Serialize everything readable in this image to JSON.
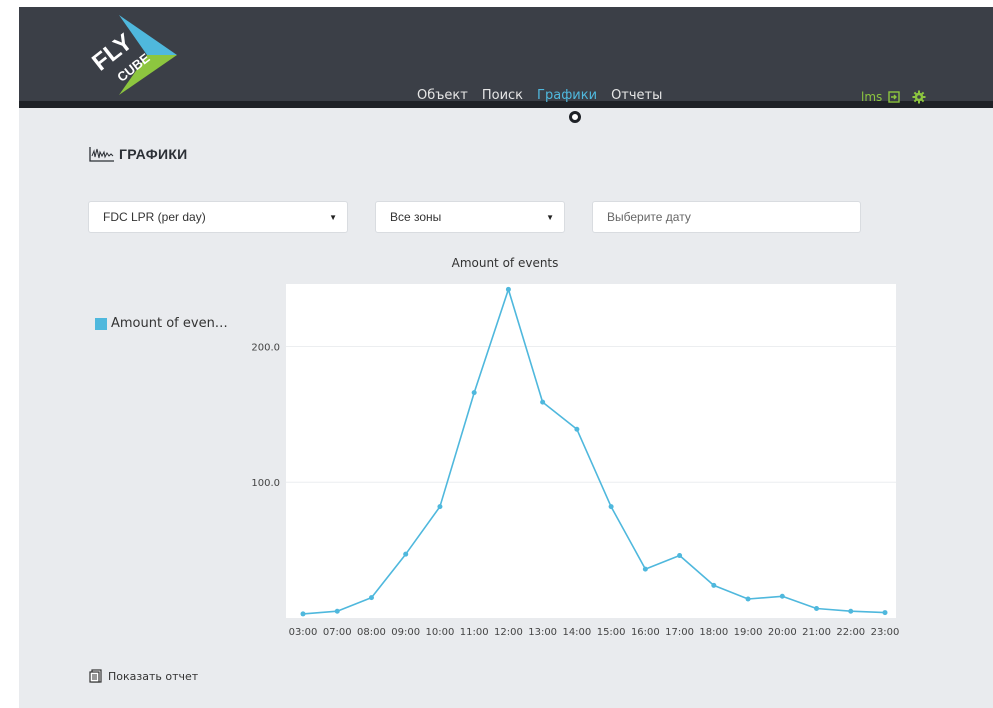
{
  "brand": {
    "logo_line1": "FLY",
    "logo_line2": "CUBE",
    "colors": {
      "blue": "#4fb8dd",
      "green": "#8dc63f",
      "dark": "#3b3f47"
    }
  },
  "nav": {
    "items": [
      {
        "label": "Объект"
      },
      {
        "label": "Поиск"
      },
      {
        "label": "Графики",
        "active": true
      },
      {
        "label": "Отчеты"
      }
    ]
  },
  "user": {
    "name": "lms",
    "logout_icon": "logout-icon",
    "settings_icon": "gear-icon"
  },
  "page": {
    "title": "ГРАФИКИ",
    "title_icon": "chart-wave-icon"
  },
  "filters": {
    "report_select": "FDC LPR (per day)",
    "zone_select": "Все зоны",
    "date_placeholder": "Выберите дату"
  },
  "legend": {
    "label": "Amount of even…"
  },
  "footer": {
    "report_label": "Показать отчет",
    "report_icon": "document-icon"
  },
  "chart_data": {
    "type": "line",
    "title": "Amount of events",
    "xlabel": "",
    "ylabel": "",
    "categories": [
      "03:00",
      "07:00",
      "08:00",
      "09:00",
      "10:00",
      "11:00",
      "12:00",
      "13:00",
      "14:00",
      "15:00",
      "16:00",
      "17:00",
      "18:00",
      "19:00",
      "20:00",
      "21:00",
      "22:00",
      "23:00"
    ],
    "series": [
      {
        "name": "Amount of events",
        "values": [
          3,
          5,
          15,
          47,
          82,
          166,
          242,
          159,
          139,
          82,
          36,
          46,
          24,
          14,
          16,
          7,
          5,
          4
        ]
      }
    ],
    "yticks": [
      "100.0",
      "200.0"
    ],
    "ylim": [
      0,
      246
    ],
    "grid": true,
    "legend_position": "left",
    "color": "#4fb8dd"
  }
}
